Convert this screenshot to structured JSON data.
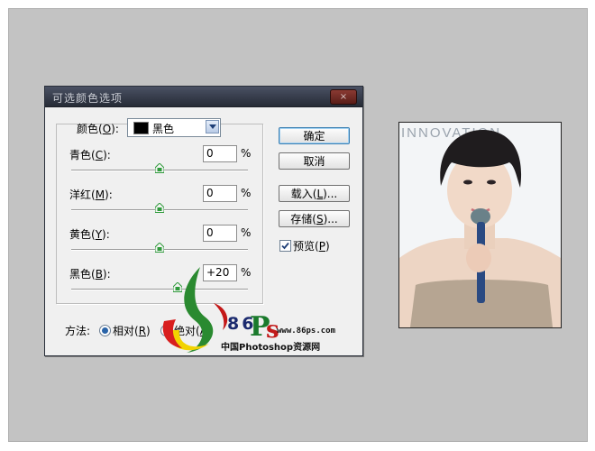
{
  "dialog": {
    "title": "可选颜色选项",
    "close": "×",
    "colors_label": "颜色(",
    "colors_key": "O",
    "colors_tail": "):",
    "colors_value": "黑色",
    "sliders": [
      {
        "label_pre": "青色(",
        "key": "C",
        "label_post": "):",
        "value": "0",
        "unit": "%",
        "level": 0.5
      },
      {
        "label_pre": "洋红(",
        "key": "M",
        "label_post": "):",
        "value": "0",
        "unit": "%",
        "level": 0.5
      },
      {
        "label_pre": "黄色(",
        "key": "Y",
        "label_post": "):",
        "value": "0",
        "unit": "%",
        "level": 0.5
      },
      {
        "label_pre": "黑色(",
        "key": "B",
        "label_post": "):",
        "value": "+20",
        "unit": "%",
        "level": 0.6
      }
    ],
    "buttons": {
      "ok": "确定",
      "cancel": "取消",
      "load_pre": "载入(",
      "load_key": "L",
      "load_post": ")...",
      "save_pre": "存储(",
      "save_key": "S",
      "save_post": ")..."
    },
    "preview": {
      "pre": "预览(",
      "key": "P",
      "post": ")",
      "checked": true
    },
    "method": {
      "label": "方法:",
      "relative_pre": "相对(",
      "relative_key": "R",
      "relative_post": ")",
      "absolute_pre": "绝对(",
      "absolute_key": "A",
      "absolute_post": ")",
      "selected": "relative"
    }
  },
  "watermark": {
    "number": "86",
    "url": "www.86ps.com",
    "caption": "中国Photoshop资源网"
  },
  "photo": {
    "backdrop_text": "INNOVATION"
  },
  "colors": {
    "canvas": "#c3c3c3",
    "titlebar": "#2f3440",
    "dialog_bg": "#f0f0f0",
    "thumb": "#2e9a3a"
  }
}
